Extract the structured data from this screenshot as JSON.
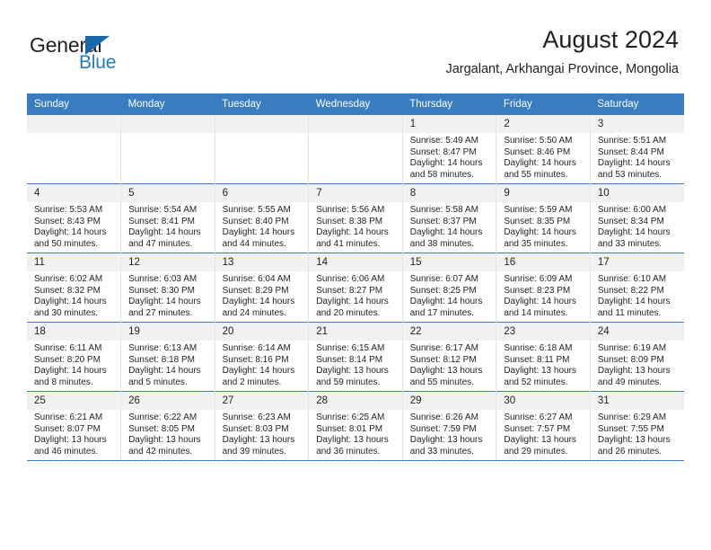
{
  "brand": {
    "line1": "General",
    "line2": "Blue",
    "triangle_color": "#1767ad",
    "blue_color": "#1f7ac4"
  },
  "header": {
    "title": "August 2024",
    "subtitle": "Jargalant, Arkhangai Province, Mongolia"
  },
  "theme": {
    "header_bg": "#3a7cc0",
    "daynum_bg": "#f1f1f1",
    "text": "#231f20"
  },
  "weekday_headers": [
    "Sunday",
    "Monday",
    "Tuesday",
    "Wednesday",
    "Thursday",
    "Friday",
    "Saturday"
  ],
  "weeks": [
    [
      {
        "day": "",
        "empty": true
      },
      {
        "day": "",
        "empty": true
      },
      {
        "day": "",
        "empty": true
      },
      {
        "day": "",
        "empty": true
      },
      {
        "day": "1",
        "sunrise": "Sunrise: 5:49 AM",
        "sunset": "Sunset: 8:47 PM",
        "daylight1": "Daylight: 14 hours",
        "daylight2": "and 58 minutes."
      },
      {
        "day": "2",
        "sunrise": "Sunrise: 5:50 AM",
        "sunset": "Sunset: 8:46 PM",
        "daylight1": "Daylight: 14 hours",
        "daylight2": "and 55 minutes."
      },
      {
        "day": "3",
        "sunrise": "Sunrise: 5:51 AM",
        "sunset": "Sunset: 8:44 PM",
        "daylight1": "Daylight: 14 hours",
        "daylight2": "and 53 minutes."
      }
    ],
    [
      {
        "day": "4",
        "sunrise": "Sunrise: 5:53 AM",
        "sunset": "Sunset: 8:43 PM",
        "daylight1": "Daylight: 14 hours",
        "daylight2": "and 50 minutes."
      },
      {
        "day": "5",
        "sunrise": "Sunrise: 5:54 AM",
        "sunset": "Sunset: 8:41 PM",
        "daylight1": "Daylight: 14 hours",
        "daylight2": "and 47 minutes."
      },
      {
        "day": "6",
        "sunrise": "Sunrise: 5:55 AM",
        "sunset": "Sunset: 8:40 PM",
        "daylight1": "Daylight: 14 hours",
        "daylight2": "and 44 minutes."
      },
      {
        "day": "7",
        "sunrise": "Sunrise: 5:56 AM",
        "sunset": "Sunset: 8:38 PM",
        "daylight1": "Daylight: 14 hours",
        "daylight2": "and 41 minutes."
      },
      {
        "day": "8",
        "sunrise": "Sunrise: 5:58 AM",
        "sunset": "Sunset: 8:37 PM",
        "daylight1": "Daylight: 14 hours",
        "daylight2": "and 38 minutes."
      },
      {
        "day": "9",
        "sunrise": "Sunrise: 5:59 AM",
        "sunset": "Sunset: 8:35 PM",
        "daylight1": "Daylight: 14 hours",
        "daylight2": "and 35 minutes."
      },
      {
        "day": "10",
        "sunrise": "Sunrise: 6:00 AM",
        "sunset": "Sunset: 8:34 PM",
        "daylight1": "Daylight: 14 hours",
        "daylight2": "and 33 minutes."
      }
    ],
    [
      {
        "day": "11",
        "sunrise": "Sunrise: 6:02 AM",
        "sunset": "Sunset: 8:32 PM",
        "daylight1": "Daylight: 14 hours",
        "daylight2": "and 30 minutes."
      },
      {
        "day": "12",
        "sunrise": "Sunrise: 6:03 AM",
        "sunset": "Sunset: 8:30 PM",
        "daylight1": "Daylight: 14 hours",
        "daylight2": "and 27 minutes."
      },
      {
        "day": "13",
        "sunrise": "Sunrise: 6:04 AM",
        "sunset": "Sunset: 8:29 PM",
        "daylight1": "Daylight: 14 hours",
        "daylight2": "and 24 minutes."
      },
      {
        "day": "14",
        "sunrise": "Sunrise: 6:06 AM",
        "sunset": "Sunset: 8:27 PM",
        "daylight1": "Daylight: 14 hours",
        "daylight2": "and 20 minutes."
      },
      {
        "day": "15",
        "sunrise": "Sunrise: 6:07 AM",
        "sunset": "Sunset: 8:25 PM",
        "daylight1": "Daylight: 14 hours",
        "daylight2": "and 17 minutes."
      },
      {
        "day": "16",
        "sunrise": "Sunrise: 6:09 AM",
        "sunset": "Sunset: 8:23 PM",
        "daylight1": "Daylight: 14 hours",
        "daylight2": "and 14 minutes."
      },
      {
        "day": "17",
        "sunrise": "Sunrise: 6:10 AM",
        "sunset": "Sunset: 8:22 PM",
        "daylight1": "Daylight: 14 hours",
        "daylight2": "and 11 minutes."
      }
    ],
    [
      {
        "day": "18",
        "sunrise": "Sunrise: 6:11 AM",
        "sunset": "Sunset: 8:20 PM",
        "daylight1": "Daylight: 14 hours",
        "daylight2": "and 8 minutes."
      },
      {
        "day": "19",
        "sunrise": "Sunrise: 6:13 AM",
        "sunset": "Sunset: 8:18 PM",
        "daylight1": "Daylight: 14 hours",
        "daylight2": "and 5 minutes."
      },
      {
        "day": "20",
        "sunrise": "Sunrise: 6:14 AM",
        "sunset": "Sunset: 8:16 PM",
        "daylight1": "Daylight: 14 hours",
        "daylight2": "and 2 minutes."
      },
      {
        "day": "21",
        "sunrise": "Sunrise: 6:15 AM",
        "sunset": "Sunset: 8:14 PM",
        "daylight1": "Daylight: 13 hours",
        "daylight2": "and 59 minutes."
      },
      {
        "day": "22",
        "sunrise": "Sunrise: 6:17 AM",
        "sunset": "Sunset: 8:12 PM",
        "daylight1": "Daylight: 13 hours",
        "daylight2": "and 55 minutes."
      },
      {
        "day": "23",
        "sunrise": "Sunrise: 6:18 AM",
        "sunset": "Sunset: 8:11 PM",
        "daylight1": "Daylight: 13 hours",
        "daylight2": "and 52 minutes."
      },
      {
        "day": "24",
        "sunrise": "Sunrise: 6:19 AM",
        "sunset": "Sunset: 8:09 PM",
        "daylight1": "Daylight: 13 hours",
        "daylight2": "and 49 minutes."
      }
    ],
    [
      {
        "day": "25",
        "sunrise": "Sunrise: 6:21 AM",
        "sunset": "Sunset: 8:07 PM",
        "daylight1": "Daylight: 13 hours",
        "daylight2": "and 46 minutes."
      },
      {
        "day": "26",
        "sunrise": "Sunrise: 6:22 AM",
        "sunset": "Sunset: 8:05 PM",
        "daylight1": "Daylight: 13 hours",
        "daylight2": "and 42 minutes."
      },
      {
        "day": "27",
        "sunrise": "Sunrise: 6:23 AM",
        "sunset": "Sunset: 8:03 PM",
        "daylight1": "Daylight: 13 hours",
        "daylight2": "and 39 minutes."
      },
      {
        "day": "28",
        "sunrise": "Sunrise: 6:25 AM",
        "sunset": "Sunset: 8:01 PM",
        "daylight1": "Daylight: 13 hours",
        "daylight2": "and 36 minutes."
      },
      {
        "day": "29",
        "sunrise": "Sunrise: 6:26 AM",
        "sunset": "Sunset: 7:59 PM",
        "daylight1": "Daylight: 13 hours",
        "daylight2": "and 33 minutes."
      },
      {
        "day": "30",
        "sunrise": "Sunrise: 6:27 AM",
        "sunset": "Sunset: 7:57 PM",
        "daylight1": "Daylight: 13 hours",
        "daylight2": "and 29 minutes."
      },
      {
        "day": "31",
        "sunrise": "Sunrise: 6:29 AM",
        "sunset": "Sunset: 7:55 PM",
        "daylight1": "Daylight: 13 hours",
        "daylight2": "and 26 minutes."
      }
    ]
  ]
}
